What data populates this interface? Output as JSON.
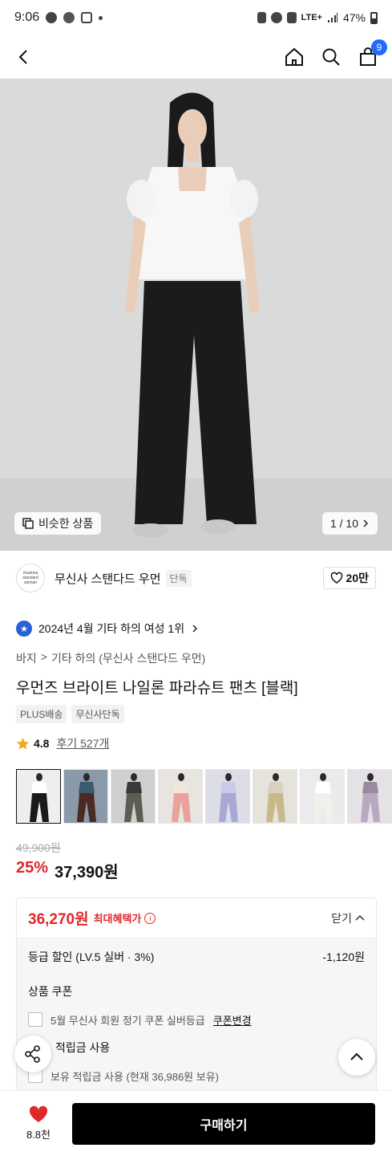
{
  "status_bar": {
    "time": "9:06",
    "network": "LTE+",
    "battery": "47%"
  },
  "nav": {
    "cart_count": "9"
  },
  "hero": {
    "similar_label": "비슷한 상품",
    "page_indicator": "1 / 10"
  },
  "brand": {
    "logo_text": "musinsa standard woman",
    "name": "무신사 스탠다드 우먼",
    "tag": "단독",
    "likes": "20만"
  },
  "rank": {
    "text": "2024년 4월 기타 하의 여성 1위"
  },
  "breadcrumb": [
    "바지",
    "기타 하의 (무신사 스탠다드 우먼)"
  ],
  "product": {
    "title": "우먼즈 브라이트 나일론 파라슈트 팬츠 [블랙]",
    "tags": [
      "PLUS배송",
      "무신사단독"
    ],
    "rating": "4.8",
    "review_label": "후기 527개",
    "original_price": "49,900원",
    "discount": "25%",
    "price": "37,390원"
  },
  "thumbnails": [
    {
      "color": "#eeeeee",
      "pants": "#1a1a1a",
      "top": "#ffffff"
    },
    {
      "color": "#8a9aa8",
      "pants": "#4a2a22",
      "top": "#3b5a70"
    },
    {
      "color": "#cfcfcf",
      "pants": "#5c5e52",
      "top": "#3a3a3a"
    },
    {
      "color": "#e8e4e0",
      "pants": "#e8a49a",
      "top": "#f0e6dc"
    },
    {
      "color": "#dcdde6",
      "pants": "#a8a8d6",
      "top": "#c9c9e8"
    },
    {
      "color": "#e6e3dd",
      "pants": "#c9b98a",
      "top": "#d8d0c0"
    },
    {
      "color": "#ebebeb",
      "pants": "#f2f0ea",
      "top": "#ffffff"
    },
    {
      "color": "#e4e2e4",
      "pants": "#b8a8c0",
      "top": "#9a8aa0"
    }
  ],
  "benefit": {
    "max_price": "36,270원",
    "max_label": "최대혜택가",
    "toggle_label": "닫기",
    "grade_label": "등급 할인 (LV.5 실버 · 3%)",
    "grade_value": "-1,120원",
    "coupon_section": "상품 쿠폰",
    "coupon_text": "5월 무신사 회원 정기 쿠폰 실버등급",
    "coupon_change": "쿠폰변경",
    "points_section": "적립금 사용",
    "points_text": "보유 적립금 사용 (현재 36,986원 보유)"
  },
  "bottom": {
    "wish_count": "8.8천",
    "buy_label": "구매하기"
  }
}
